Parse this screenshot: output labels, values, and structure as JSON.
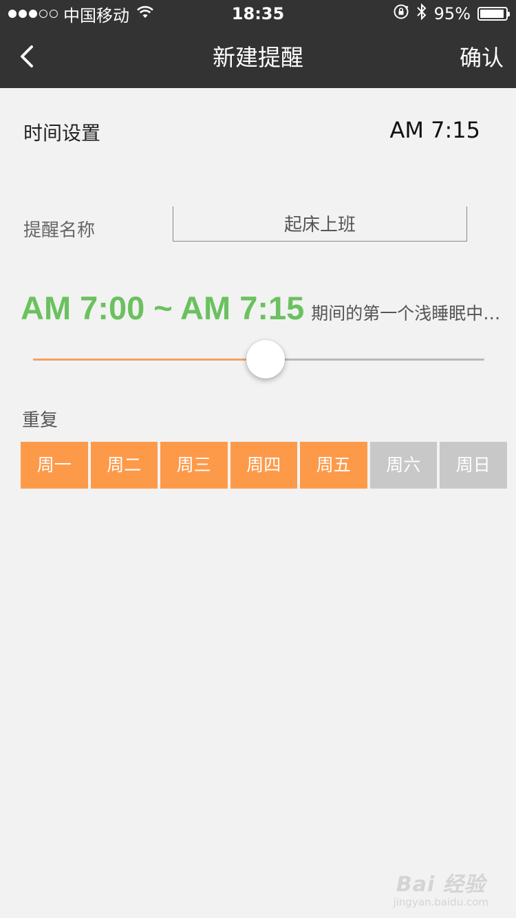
{
  "status_bar": {
    "carrier": "中国移动",
    "time": "18:35",
    "battery_text": "95%",
    "battery_level": 0.95,
    "signal_full": 3,
    "signal_total": 5,
    "icons": [
      "wifi-icon",
      "rotation-lock-icon",
      "bluetooth-icon",
      "battery-icon"
    ]
  },
  "nav": {
    "back_icon": "chevron-left-icon",
    "title": "新建提醒",
    "confirm_label": "确认"
  },
  "time_setting": {
    "label": "时间设置",
    "value": "AM 7:15"
  },
  "reminder_name": {
    "label": "提醒名称",
    "value": "起床上班"
  },
  "wake_window": {
    "range_text": "AM 7:00 ~ AM 7:15",
    "description": "期间的第一个浅睡眠中…",
    "color": "#6bc15f"
  },
  "slider": {
    "value": 0.515,
    "fill_color": "#f5a061",
    "track_color": "#b8b8b8"
  },
  "repeat": {
    "label": "重复",
    "active_color": "#fd9a4a",
    "inactive_color": "#c8c8c8",
    "days": [
      {
        "label": "周一",
        "selected": true
      },
      {
        "label": "周二",
        "selected": true
      },
      {
        "label": "周三",
        "selected": true
      },
      {
        "label": "周四",
        "selected": true
      },
      {
        "label": "周五",
        "selected": true
      },
      {
        "label": "周六",
        "selected": false
      },
      {
        "label": "周日",
        "selected": false
      }
    ]
  },
  "watermark": {
    "main": "Bai 经验",
    "sub": "jingyan.baidu.com"
  }
}
